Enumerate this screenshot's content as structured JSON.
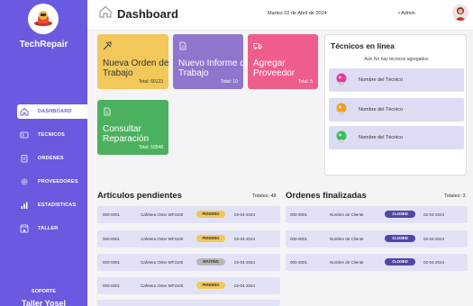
{
  "app": {
    "brand": "TechRepair"
  },
  "colors": {
    "sidebar": "#6a5ae0",
    "yellow": "#f2c85b",
    "purple": "#8f76cc",
    "pink": "#ef5e8a",
    "green": "#4bb15e",
    "row": "#e2e2f6",
    "closed": "#5046a8"
  },
  "sidebar": {
    "items": [
      {
        "label": "DASHBOARD",
        "icon": "home-icon",
        "active": true
      },
      {
        "label": "TECNICOS",
        "icon": "id-card-icon"
      },
      {
        "label": "ORDENES",
        "icon": "clipboard-icon"
      },
      {
        "label": "PROVEEDORES",
        "icon": "gear-icon"
      },
      {
        "label": "ESTADISTICAS",
        "icon": "bar-chart-icon"
      },
      {
        "label": "TALLER",
        "icon": "store-icon"
      }
    ],
    "soporte": "SOPORTE",
    "footer_cut": "Taller Yosel"
  },
  "header": {
    "title": "Dashboard",
    "date": "Martes 02 de Abril de 2024",
    "user": "• Admin"
  },
  "cards": [
    {
      "label": "Nueva Orden de Trabajo",
      "total": "Total: 60123",
      "icon": "tools-icon"
    },
    {
      "label": "Nuevo Informe de Trabajo",
      "total": "Total: 10",
      "icon": "document-icon"
    },
    {
      "label": "Agregar Proveedor",
      "total": "Total: 5",
      "icon": "truck-icon"
    },
    {
      "label": "Consultar Reparación",
      "total": "Total: 50548",
      "icon": "document-icon"
    }
  ],
  "techs": {
    "title": "Técnicos en línea",
    "subtitle": "Aún No hay técnicos agregados",
    "items": [
      {
        "name": "Nombre del Técnico",
        "color": "#e83a9a"
      },
      {
        "name": "Nombre del Técnico",
        "color": "#f0a020"
      },
      {
        "name": "Nombre del Técnico",
        "color": "#38c050"
      }
    ]
  },
  "pending": {
    "title": "Artículos pendientes",
    "total": "Totales: 48",
    "rows": [
      {
        "id": "000-0001",
        "item": "Cafetera Oster MF3100",
        "status": "PENDING",
        "date": "02-04-2024"
      },
      {
        "id": "000-0001",
        "item": "Cafetera Oster MF3100",
        "status": "PENDING",
        "date": "02-04-2024"
      },
      {
        "id": "000-0001",
        "item": "Cafetera Oster MF3100",
        "status": "WAITING",
        "date": "02-04-2024"
      },
      {
        "id": "000-0001",
        "item": "Cafetera Oster MF3100",
        "status": "PENDING",
        "date": "02-04-2024"
      }
    ]
  },
  "finished": {
    "title": "Ordenes  finalizadas",
    "total": "Totales: 3",
    "rows": [
      {
        "id": "000-0001",
        "client": "Nombre de Cliente",
        "status": "CLOSED",
        "date": "02-04-2024"
      },
      {
        "id": "000-0001",
        "client": "Nombre de Cliente",
        "status": "CLOSED",
        "date": "02-04-2024"
      },
      {
        "id": "000-0001",
        "client": "Nombre de Cliente",
        "status": "CLOSED",
        "date": "02-04-2024"
      }
    ]
  }
}
